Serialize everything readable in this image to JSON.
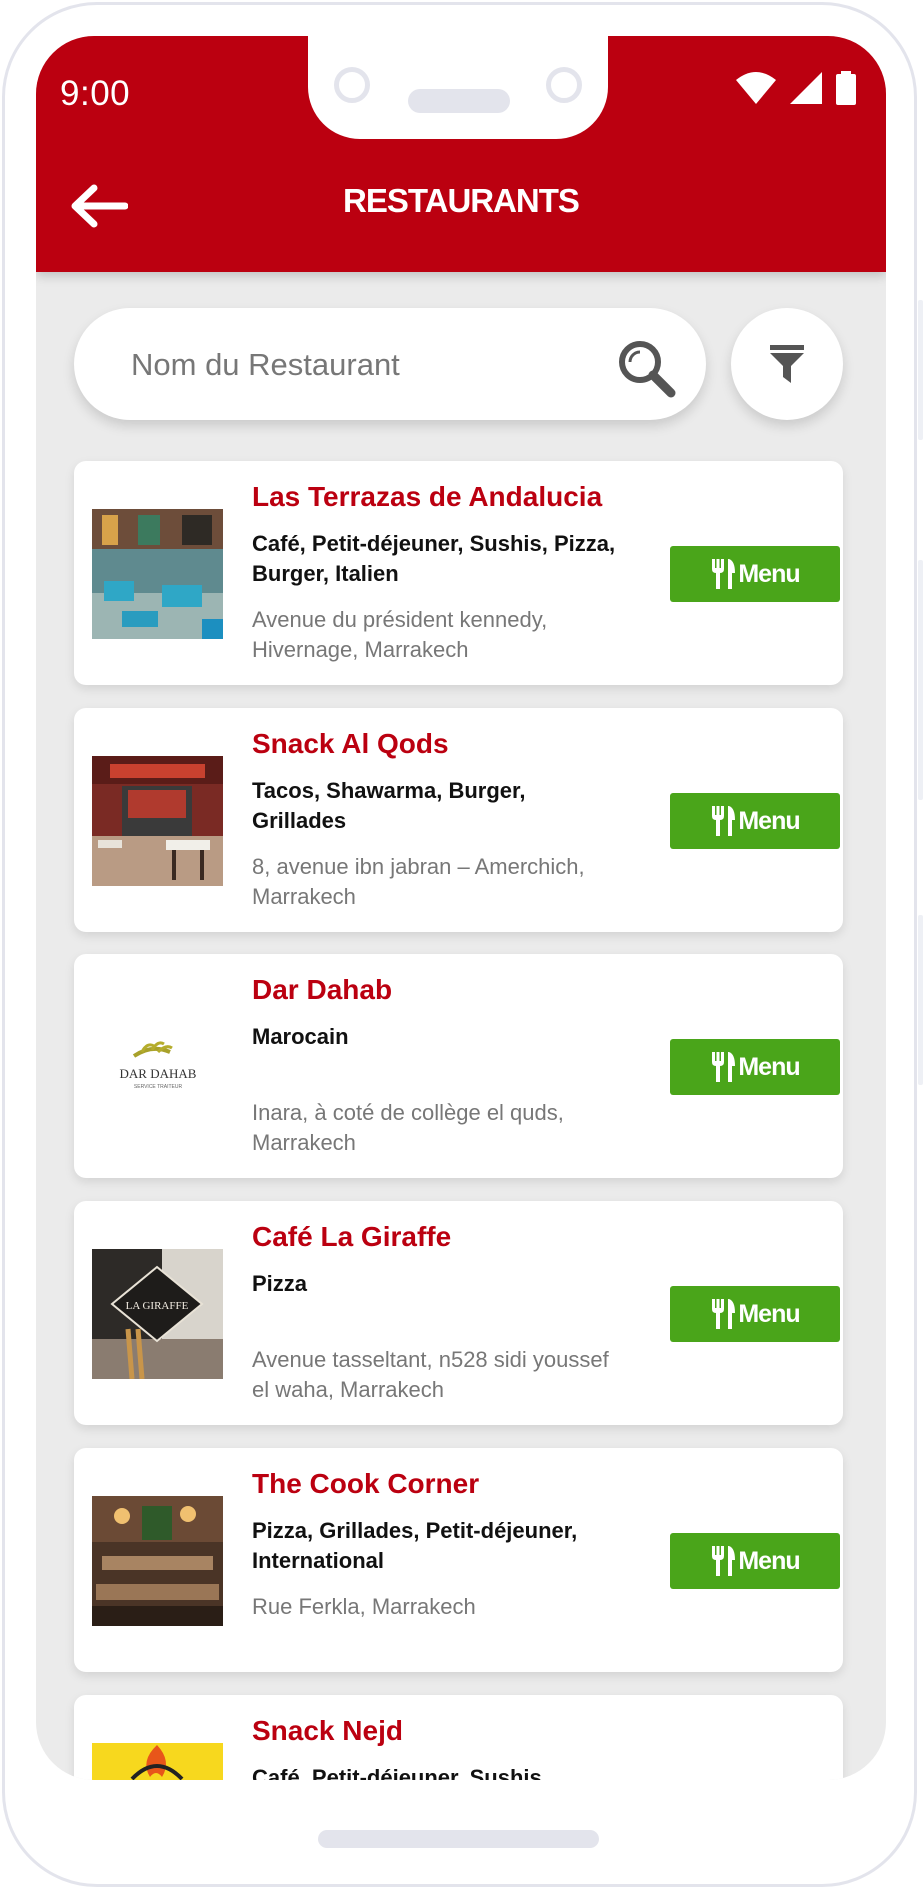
{
  "status_bar": {
    "time": "9:00"
  },
  "header": {
    "title": "RESTAURANTS",
    "color": "#bb0010"
  },
  "search": {
    "placeholder": "Nom du Restaurant"
  },
  "menu_button_label": "Menu",
  "restaurants": [
    {
      "name": "Las Terrazas de Andalucia",
      "cuisine": "Café, Petit-déjeuner, Sushis, Pizza, Burger, Italien",
      "address": "Avenue du président kennedy, Hivernage, Marrakech"
    },
    {
      "name": "Snack Al Qods",
      "cuisine": "Tacos, Shawarma, Burger, Grillades",
      "address": "8, avenue ibn jabran – Amerchich, Marrakech"
    },
    {
      "name": "Dar Dahab",
      "cuisine": "Marocain",
      "address": "Inara, à coté de collège el quds, Marrakech",
      "logo_text": "DAR DAHAB",
      "logo_sub": "SERVICE TRAITEUR"
    },
    {
      "name": "Café La Giraffe",
      "cuisine": "Pizza",
      "address": "Avenue tasseltant, n528 sidi youssef el waha, Marrakech",
      "logo_text": "LA GIRAFFE"
    },
    {
      "name": "The Cook Corner",
      "cuisine": "Pizza, Grillades, Petit-déjeuner, International",
      "address": "Rue Ferkla, Marrakech"
    },
    {
      "name": "Snack Nejd",
      "cuisine": "Café, Petit-déjeuner, Sushis,"
    }
  ],
  "colors": {
    "accent": "#bb0010",
    "menu_button": "#4aa51a",
    "background": "#ebebeb"
  }
}
